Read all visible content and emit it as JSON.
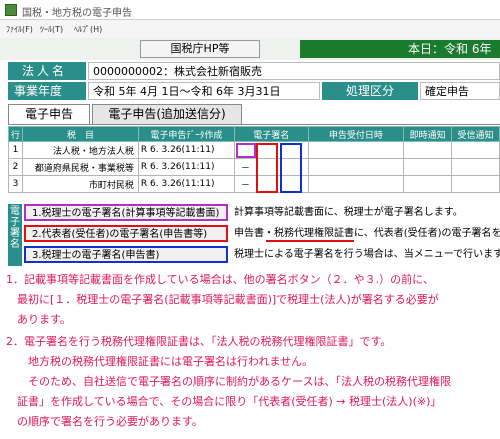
{
  "window": {
    "title": "国税・地方税の電子申告"
  },
  "menu": {
    "file": "ﾌｧｲﾙ(F)",
    "tool": "ﾂｰﾙ(T)",
    "help": "ﾍﾙﾌﾟ(H)"
  },
  "toolbar": {
    "hp_button": "国税庁HP等",
    "today": "本日：令和 6年"
  },
  "info": {
    "corp_label": "法人名",
    "corp_value": "0000000002：株式会社新宿販売",
    "year_label": "事業年度",
    "year_value": "令和 5年 4月 1日～令和 6年 3月31日",
    "proc_label": "処理区分",
    "proc_value": "確定申告"
  },
  "tabs": [
    "電子申告",
    "電子申告(追加送信分)"
  ],
  "table": {
    "headers": [
      "行",
      "税　目",
      "電子申告ﾃﾞｰﾀ作成",
      "電子署名",
      "申告受付日時",
      "即時通知",
      "受信通知"
    ],
    "rows": [
      {
        "no": "1",
        "tax": "法人税・地方法人税",
        "date": "R 6. 3.26(11:11)",
        "sig": ""
      },
      {
        "no": "2",
        "tax": "都道府県民税・事業税等",
        "date": "R 6. 3.26(11:11)",
        "sig": "－"
      },
      {
        "no": "3",
        "tax": "市町村民税",
        "date": "R 6. 3.26(11:11)",
        "sig": "－"
      }
    ]
  },
  "esig": {
    "side_label": "電子署名",
    "buttons": [
      {
        "label": "1.税理士の電子署名(計算事項等記載書面)",
        "desc": "計算事項等記載書面に、税理士が電子署名します。"
      },
      {
        "label": "2.代表者(受任者)の電子署名(申告書等)",
        "desc": "申告書・税務代理権限証書に、代表者(受任者)の電子署名を行い"
      },
      {
        "label": "3.税理士の電子署名(申告書)",
        "desc": "税理士による電子署名を行う場合は、当メニューで行います。"
      }
    ]
  },
  "notes": [
    "1．記載事項等記載書面を作成している場合は、他の署名ボタン（２．や３.）の前に、",
    "　最初に[１．税理士の電子署名(記載事項等記載書面)]で税理士(法人)が署名する必要が",
    "　あります。",
    "2．電子署名を行う税務代理権限証書は、「法人税の税務代理権限証書」です。",
    "　　地方税の税務代理権限証書には電子署名は行われません。",
    "　　そのため、自社送信で電子署名の順序に制約があるケースは、「法人税の税務代理権限",
    "　証書」を作成している場合で、その場合に限り「代表者(受任者) → 税理士(法人)(※)」",
    "　の順序で署名を行う必要があります。"
  ],
  "colors": {
    "header_teal": "#2a8e8a",
    "today_green": "#1a7a2e",
    "note_pink": "#e0195a",
    "mark_purple": "#b030c8",
    "mark_red": "#e01010",
    "mark_blue": "#1030d0"
  }
}
